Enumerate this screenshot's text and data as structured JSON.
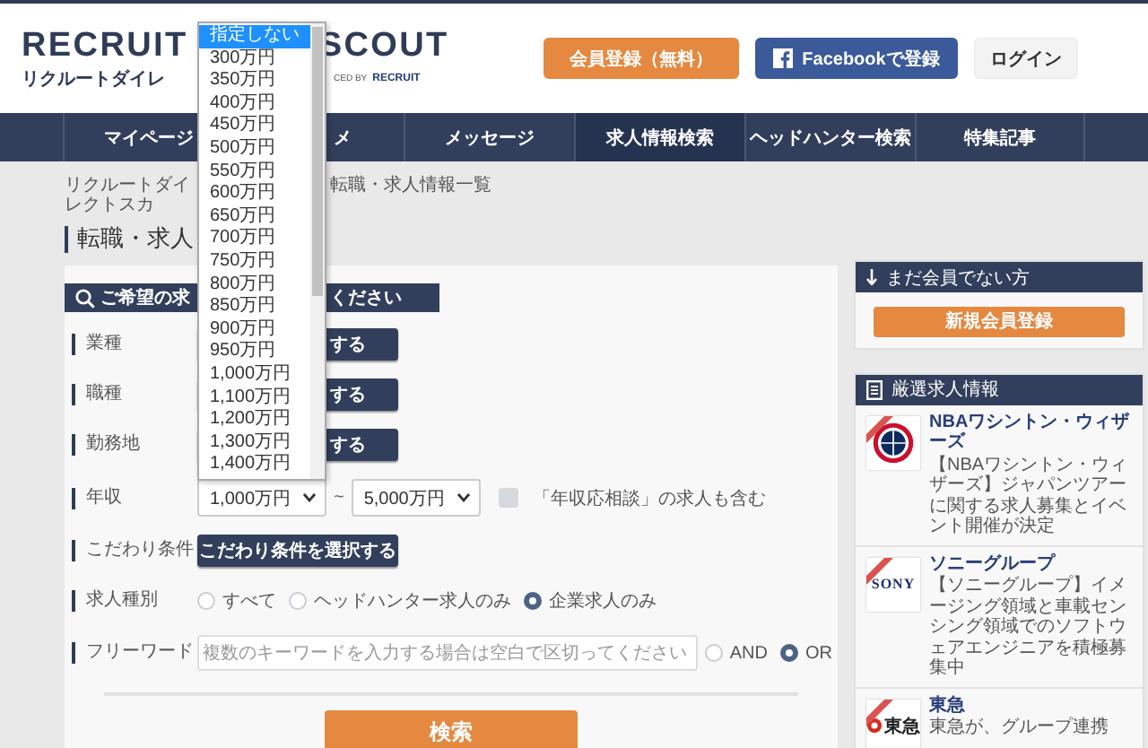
{
  "logo": {
    "wordmark_left": "RECRUIT",
    "wordmark_right": "SCOUT",
    "subtitle": "リクルートダイレ",
    "credit": "CED BY",
    "credit_brand": "RECRUIT"
  },
  "header_buttons": [
    {
      "label": "会員登録（無料）",
      "kind": "primary"
    },
    {
      "label": "Facebookで登録",
      "kind": "facebook"
    },
    {
      "label": "ログイン",
      "kind": "plain"
    }
  ],
  "nav": [
    {
      "label": "マイページ",
      "selected": false
    },
    {
      "label": "メ",
      "selected": false
    },
    {
      "label": "メッセージ",
      "selected": false
    },
    {
      "label": "求人情報検索",
      "selected": true
    },
    {
      "label": "ヘッドハンター検索",
      "selected": false
    },
    {
      "label": "特集記事",
      "selected": false
    }
  ],
  "breadcrumb": [
    "リクルートダイレクトスカ",
    "転職・求人情報一覧"
  ],
  "page_title": "転職・求人",
  "search_panel": {
    "heading_left": "ご希望の求",
    "heading_right": "ください",
    "rows": [
      {
        "label": "業種",
        "kind": "button_cut",
        "button": "する"
      },
      {
        "label": "職種",
        "kind": "button_cut",
        "button": "する"
      },
      {
        "label": "勤務地",
        "kind": "button_cut",
        "button": "する"
      },
      {
        "label": "年収",
        "kind": "salary",
        "from": "1,000万円",
        "separator": "~",
        "to": "5,000万円",
        "checkbox": {
          "label": "「年収応相談」の求人も含む",
          "checked": false
        }
      },
      {
        "label": "こだわり条件",
        "kind": "button",
        "button": "こだわり条件を選択する"
      },
      {
        "label": "求人種別",
        "kind": "radios",
        "options": [
          {
            "label": "すべて",
            "selected": false
          },
          {
            "label": "ヘッドハンター求人のみ",
            "selected": false
          },
          {
            "label": "企業求人のみ",
            "selected": true
          }
        ]
      },
      {
        "label": "フリーワード",
        "kind": "keyword",
        "placeholder": "複数のキーワードを入力する場合は空白で区切ってください",
        "options": [
          {
            "label": "AND",
            "selected": false
          },
          {
            "label": "OR",
            "selected": true
          }
        ]
      }
    ],
    "submit": "検索"
  },
  "salary_dropdown": {
    "options": [
      {
        "label": "指定しない",
        "selected": true
      },
      {
        "label": "300万円",
        "selected": false
      },
      {
        "label": "350万円",
        "selected": false
      },
      {
        "label": "400万円",
        "selected": false
      },
      {
        "label": "450万円",
        "selected": false
      },
      {
        "label": "500万円",
        "selected": false
      },
      {
        "label": "550万円",
        "selected": false
      },
      {
        "label": "600万円",
        "selected": false
      },
      {
        "label": "650万円",
        "selected": false
      },
      {
        "label": "700万円",
        "selected": false
      },
      {
        "label": "750万円",
        "selected": false
      },
      {
        "label": "800万円",
        "selected": false
      },
      {
        "label": "850万円",
        "selected": false
      },
      {
        "label": "900万円",
        "selected": false
      },
      {
        "label": "950万円",
        "selected": false
      },
      {
        "label": "1,000万円",
        "selected": false
      },
      {
        "label": "1,100万円",
        "selected": false
      },
      {
        "label": "1,200万円",
        "selected": false
      },
      {
        "label": "1,300万円",
        "selected": false
      },
      {
        "label": "1,400万円",
        "selected": false
      }
    ]
  },
  "sidebar": {
    "signup": {
      "heading": "まだ会員でない方",
      "button": "新規会員登録"
    },
    "featured": {
      "heading": "厳選求人情報",
      "items": [
        {
          "logo": {
            "kind": "emblem"
          },
          "new": true,
          "title": "NBAワシントン・ウィザーズ",
          "text": "【NBAワシントン・ウィザーズ】ジャパンツアーに関する求人募集とイベント開催が決定"
        },
        {
          "logo": {
            "kind": "wordmark",
            "text": "SONY"
          },
          "new": true,
          "title": "ソニーグループ",
          "text": "【ソニーグループ】イメージング領域と車載センシング領域でのソフトウェアエンジニアを積極募集中"
        },
        {
          "logo": {
            "kind": "mark_wordmark",
            "text": "東急"
          },
          "new": true,
          "title": "東急",
          "text": "東急が、グループ連携"
        }
      ]
    }
  }
}
